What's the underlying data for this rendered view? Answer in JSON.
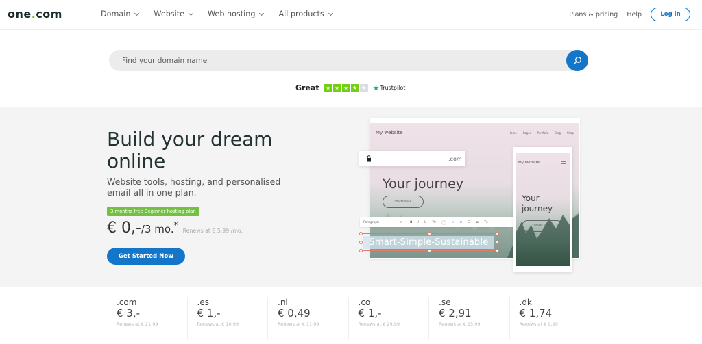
{
  "header": {
    "logo": {
      "part1": "one",
      "dot": ".",
      "part2": "com"
    },
    "nav": [
      {
        "label": "Domain"
      },
      {
        "label": "Website"
      },
      {
        "label": "Web hosting"
      },
      {
        "label": "All products"
      }
    ],
    "right_links": [
      {
        "label": "Plans & pricing"
      },
      {
        "label": "Help"
      }
    ],
    "login_label": "Log in"
  },
  "search": {
    "placeholder": "Find your domain name",
    "value": ""
  },
  "trustpilot": {
    "label": "Great",
    "rating_stars": 4,
    "max_stars": 5,
    "brand": "Trustpilot"
  },
  "hero": {
    "title": "Build your dream online",
    "subtitle": "Website tools, hosting, and personalised email all in one plan.",
    "promo_badge": "3 months free Beginner hosting plan",
    "price": "€ 0,-",
    "period": "/3 mo.",
    "asterisk": "*",
    "renews": "Renews at € 5,99 /mo.",
    "cta_label": "Get Started Now"
  },
  "illustration": {
    "desktop": {
      "site_title": "My website",
      "nav": [
        "Home",
        "Pages",
        "Portfolio",
        "Blog",
        "Shop"
      ],
      "hero_text": "Your journey",
      "button": "Starts here"
    },
    "domain_bar": {
      "tld": ".com"
    },
    "toolbar": {
      "style_select": "Paragraph",
      "items": [
        "B",
        "I",
        "U",
        "70",
        "∞",
        "≡",
        "☰",
        "≣",
        "Tx"
      ]
    },
    "editable_text": "Smart-Simple-Sustainable",
    "phone": {
      "site_title": "My website",
      "hero_line1": "Your",
      "hero_line2": "journey",
      "button": "Starts here"
    }
  },
  "domains": [
    {
      "tld": ".com",
      "price": "€ 3,-",
      "renews": "Renews at € 21,99"
    },
    {
      "tld": ".es",
      "price": "€ 1,-",
      "renews": "Renews at € 10,99"
    },
    {
      "tld": ".nl",
      "price": "€ 0,49",
      "renews": "Renews at € 11,99"
    },
    {
      "tld": ".co",
      "price": "€ 1,-",
      "renews": "Renews at € 29,99"
    },
    {
      "tld": ".se",
      "price": "€ 2,91",
      "renews": "Renews at € 15,99"
    },
    {
      "tld": ".dk",
      "price": "€ 1,74",
      "renews": "Renews at € 9,99"
    }
  ],
  "colors": {
    "brand_blue": "#1376c8",
    "logo_green": "#6bbf2b",
    "promo_green": "#74c043",
    "trustpilot_green": "#73cf11",
    "trustpilot_star": "#00b67a",
    "hero_bg": "#f4f4f4"
  }
}
